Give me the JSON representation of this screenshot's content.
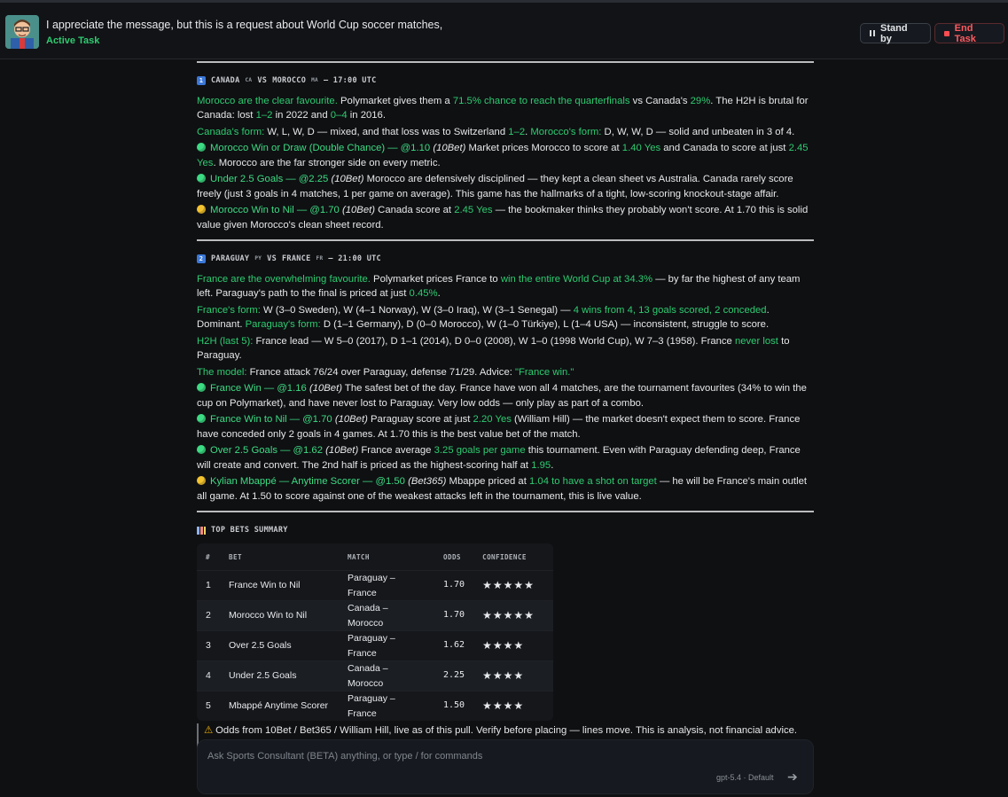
{
  "header": {
    "task_title": "I appreciate the message, but this is a request about World Cup soccer matches,",
    "task_status": "Active Task",
    "standby_label": "Stand by",
    "end_label": "End Task"
  },
  "match1": {
    "num": "1",
    "team1": "CANADA",
    "flag1": "CA",
    "vs": "VS",
    "team2": "MOROCCO",
    "flag2": "MA",
    "time": "— 17:00 UTC",
    "p1": [
      "Morocco are the clear favourite.",
      " Polymarket gives them a ",
      "71.5% chance to reach the quarterfinals",
      " vs Canada's ",
      "29%",
      ". The H2H is brutal for Canada: lost ",
      "1–2",
      " in 2022 and ",
      "0–4",
      " in 2016."
    ],
    "p2": [
      "Canada's form:",
      " W, L, W, D — mixed, and that loss was to Switzerland ",
      "1–2",
      ". ",
      "Morocco's form:",
      " D, W, W, D — solid and unbeaten in 3 of 4."
    ],
    "b1": [
      "Morocco Win or Draw (Double Chance) — @1.10",
      " ",
      "(10Bet)",
      " Market prices Morocco to score at ",
      "1.40 Yes",
      " and Canada to score at just ",
      "2.45 Yes",
      ". Morocco are the far stronger side on every metric."
    ],
    "b2": [
      "Under 2.5 Goals — @2.25",
      " ",
      "(10Bet)",
      " Morocco are defensively disciplined — they kept a clean sheet vs Australia. Canada rarely score freely (just 3 goals in 4 matches, 1 per game on average). This game has the hallmarks of a tight, low-scoring knockout-stage affair."
    ],
    "b3": [
      "Morocco Win to Nil — @1.70",
      " ",
      "(10Bet)",
      " Canada score at ",
      "2.45 Yes",
      " — the bookmaker thinks they probably won't score. At 1.70 this is solid value given Morocco's clean sheet record."
    ]
  },
  "match2": {
    "num": "2",
    "team1": "PARAGUAY",
    "flag1": "PY",
    "vs": "VS",
    "team2": "FRANCE",
    "flag2": "FR",
    "time": "— 21:00 UTC",
    "p1": [
      "France are the overwhelming favourite.",
      " Polymarket prices France to ",
      "win the entire World Cup at 34.3%",
      " — by far the highest of any team left. Paraguay's path to the final is priced at just ",
      "0.45%",
      "."
    ],
    "p2": [
      "France's form:",
      " W (3–0 Sweden), W (4–1 Norway), W (3–0 Iraq), W (3–1 Senegal) — ",
      "4 wins from 4, 13 goals scored, 2 conceded",
      ". Dominant. ",
      "Paraguay's form:",
      " D (1–1 Germany), D (0–0 Morocco), W (1–0 Türkiye), L (1–4 USA) — inconsistent, struggle to score."
    ],
    "p3": [
      "H2H (last 5):",
      " France lead — W 5–0 (2017), D 1–1 (2014), D 0–0 (2008), W 1–0 (1998 World Cup), W 7–3 (1958). France ",
      "never lost",
      " to Paraguay."
    ],
    "p4": [
      "The model:",
      " France attack 76/24 over Paraguay, defense 71/29. Advice: ",
      "\"France win.\""
    ],
    "b1": [
      "France Win — @1.16",
      " ",
      "(10Bet)",
      " The safest bet of the day. France have won all 4 matches, are the tournament favourites (34% to win the cup on Polymarket), and have never lost to Paraguay. Very low odds — only play as part of a combo."
    ],
    "b2": [
      "France Win to Nil — @1.70",
      " ",
      "(10Bet)",
      " Paraguay score at just ",
      "2.20 Yes",
      " (William Hill) — the market doesn't expect them to score. France have conceded only 2 goals in 4 games. At 1.70 this is the best value bet of the match."
    ],
    "b3": [
      "Over 2.5 Goals — @1.62",
      " ",
      "(10Bet)",
      " France average ",
      "3.25 goals per game",
      " this tournament. Even with Paraguay defending deep, France will create and convert. The 2nd half is priced as the highest-scoring half at ",
      "1.95",
      "."
    ],
    "b4": [
      "Kylian Mbappé — Anytime Scorer — @1.50",
      " ",
      "(Bet365)",
      " Mbappe priced at ",
      "1.04 to have a shot on target",
      " — he will be France's main outlet all game. At 1.50 to score against one of the weakest attacks left in the tournament, this is live value."
    ]
  },
  "summary": {
    "title": "TOP BETS SUMMARY",
    "headers": [
      "#",
      "BET",
      "MATCH",
      "ODDS",
      "CONFIDENCE"
    ],
    "rows": [
      {
        "n": "1",
        "bet": "France Win to Nil",
        "match": "Paraguay – France",
        "odds": "1.70",
        "stars": 5
      },
      {
        "n": "2",
        "bet": "Morocco Win to Nil",
        "match": "Canada – Morocco",
        "odds": "1.70",
        "stars": 5
      },
      {
        "n": "3",
        "bet": "Over 2.5 Goals",
        "match": "Paraguay – France",
        "odds": "1.62",
        "stars": 4
      },
      {
        "n": "4",
        "bet": "Under 2.5 Goals",
        "match": "Canada – Morocco",
        "odds": "2.25",
        "stars": 4
      },
      {
        "n": "5",
        "bet": "Mbappé Anytime Scorer",
        "match": "Paraguay – France",
        "odds": "1.50",
        "stars": 4
      }
    ],
    "disclaimer": "Odds from 10Bet / Bet365 / William Hill, live as of this pull. Verify before placing — lines move. This is analysis, not financial advice. Bet responsibly."
  },
  "composer": {
    "placeholder": "Ask Sports Consultant (BETA) anything, or type / for commands",
    "model": "gpt-5.4 · Default"
  },
  "colors": {
    "accent_green": "#2ecc71",
    "danger": "#ff5a5f",
    "star": "#f4c430"
  },
  "icons": {
    "standby": "pause-icon",
    "end": "stop-icon",
    "send": "arrow-right-icon",
    "warning": "warning-icon"
  }
}
